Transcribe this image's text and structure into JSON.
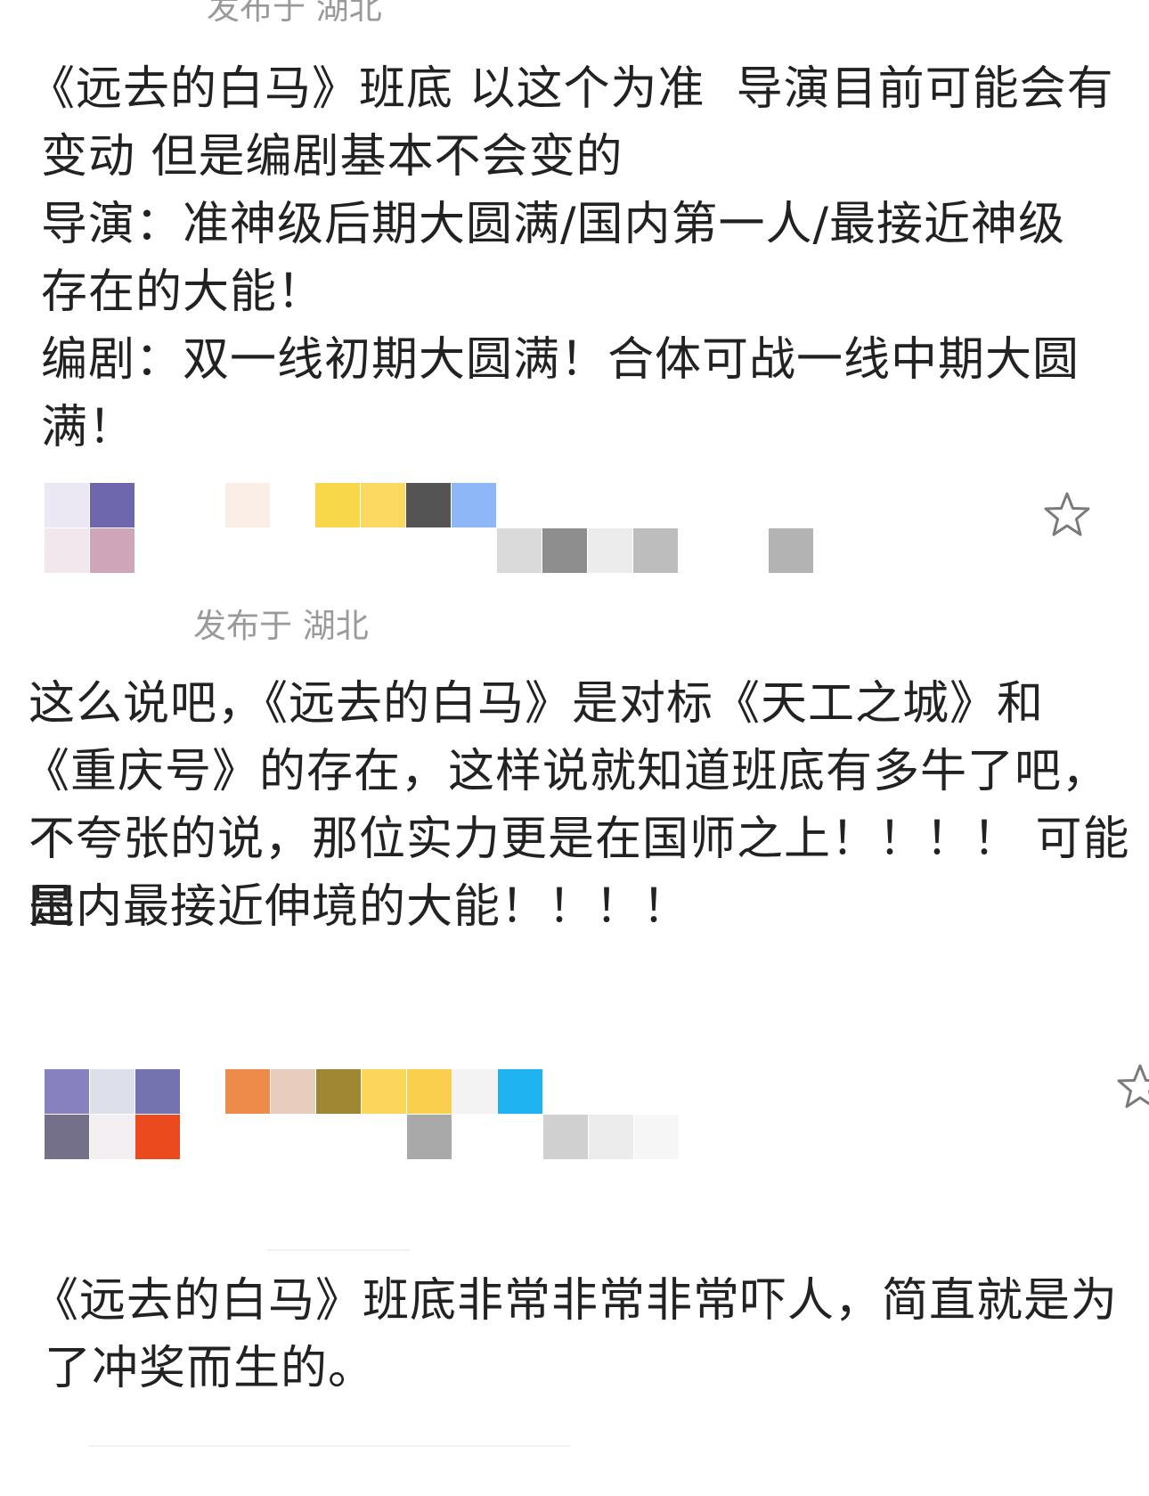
{
  "comments": [
    {
      "location": "发布于 湖北",
      "lines": [
        "《远去的白马》班底 以这个为准  导演目前可能会有",
        "变动 但是编剧基本不会变的",
        "导演：准神级后期大圆满/国内第一人/最接近神级",
        "存在的大能！",
        "编剧：双一线初期大圆满！合体可战一线中期大圆",
        "满！"
      ]
    },
    {
      "location": "发布于 湖北",
      "lines": [
        "这么说吧，《远去的白马》是对标《天工之城》和",
        "《重庆号》的存在，这样说就知道班底有多牛了吧，",
        "不夸张的说，那位实力更是在国师之上！！！！ 可能是",
        "国内最接近伸境的大能！！！！"
      ]
    },
    {
      "lines": [
        "《远去的白马》班底非常非常非常吓人，简直就是为",
        "了冲奖而生的。"
      ]
    }
  ],
  "icons": {
    "favorite": "star-outline-icon"
  },
  "colors": {
    "meta": "#9a9a9a",
    "text": "#222222",
    "star": "#7a7a7a"
  }
}
